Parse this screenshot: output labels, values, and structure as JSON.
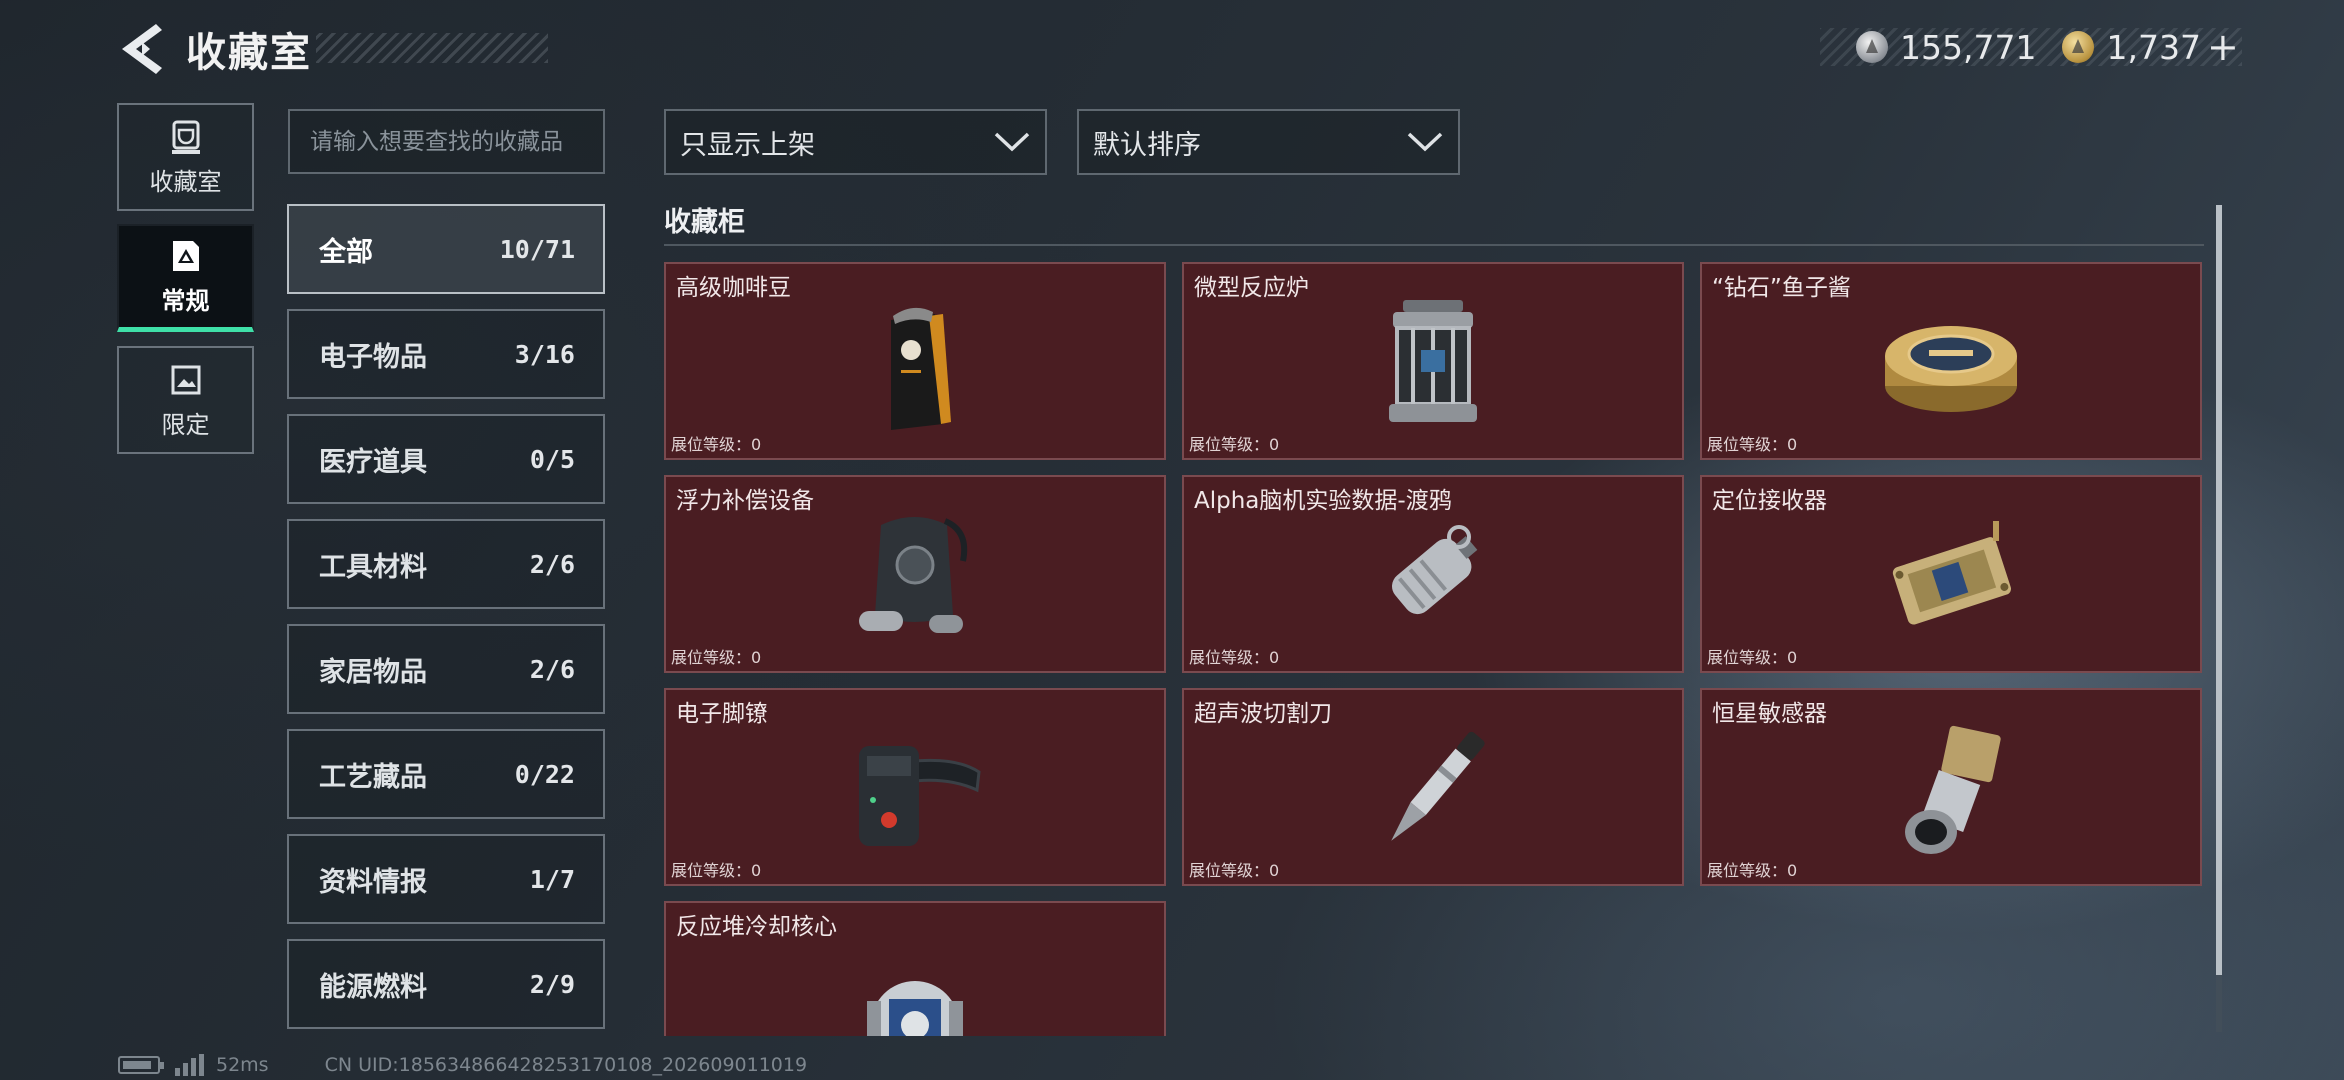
{
  "header": {
    "title": "收藏室",
    "currencies": [
      {
        "icon": "silver-coin-icon",
        "value": "155,771"
      },
      {
        "icon": "gold-coin-icon",
        "value": "1,737"
      }
    ],
    "add_label": "+"
  },
  "nav": {
    "tabs": [
      {
        "label": "收藏室",
        "icon": "trophy-icon",
        "active": false
      },
      {
        "label": "常规",
        "icon": "frame-icon",
        "active": true
      },
      {
        "label": "限定",
        "icon": "picture-icon",
        "active": false
      }
    ]
  },
  "search": {
    "placeholder": "请输入想要查找的收藏品",
    "value": ""
  },
  "filters": {
    "shelf_filter": "只显示上架",
    "sort": "默认排序"
  },
  "categories": [
    {
      "name": "全部",
      "count": "10/71",
      "active": true
    },
    {
      "name": "电子物品",
      "count": "3/16"
    },
    {
      "name": "医疗道具",
      "count": "0/5"
    },
    {
      "name": "工具材料",
      "count": "2/6"
    },
    {
      "name": "家居物品",
      "count": "2/6"
    },
    {
      "name": "工艺藏品",
      "count": "0/22"
    },
    {
      "name": "资料情报",
      "count": "1/7"
    },
    {
      "name": "能源燃料",
      "count": "2/9"
    }
  ],
  "section": {
    "title": "收藏柜"
  },
  "items": [
    {
      "name": "高级咖啡豆",
      "level": "展位等级：0",
      "icon": "coffee-bag-icon"
    },
    {
      "name": "微型反应炉",
      "level": "展位等级：0",
      "icon": "reactor-icon"
    },
    {
      "name": "“钻石”鱼子酱",
      "level": "展位等级：0",
      "icon": "caviar-tin-icon"
    },
    {
      "name": "浮力补偿设备",
      "level": "展位等级：0",
      "icon": "buoyancy-device-icon"
    },
    {
      "name": "Alpha脑机实验数据-渡鸦",
      "level": "展位等级：0",
      "icon": "data-drive-icon"
    },
    {
      "name": "定位接收器",
      "level": "展位等级：0",
      "icon": "receiver-module-icon"
    },
    {
      "name": "电子脚镣",
      "level": "展位等级：0",
      "icon": "ankle-monitor-icon"
    },
    {
      "name": "超声波切割刀",
      "level": "展位等级：0",
      "icon": "cutter-knife-icon"
    },
    {
      "name": "恒星敏感器",
      "level": "展位等级：0",
      "icon": "star-sensor-icon"
    },
    {
      "name": "反应堆冷却核心",
      "level": "",
      "icon": "cooling-core-icon"
    }
  ],
  "status": {
    "ping": "52ms",
    "uid": "CN UID:185634866428253170108_202609011019"
  },
  "colors": {
    "card_bg": "#4a1d22",
    "active_accent": "#3fe0a8"
  }
}
